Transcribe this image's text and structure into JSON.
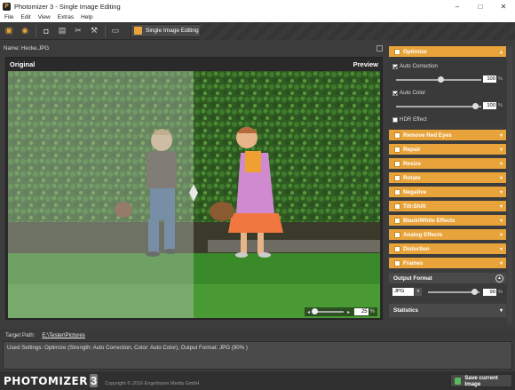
{
  "window": {
    "title": "Photomizer 3 - Single Image Editing",
    "btn_min": "–",
    "btn_max": "□",
    "btn_close": "✕"
  },
  "menu": [
    "File",
    "Edit",
    "View",
    "Extras",
    "Help"
  ],
  "toolbar": {
    "mode_label": "Single Image Editing",
    "mode_arrow": "▾"
  },
  "file": {
    "name_label": "Name: Hecke.JPG"
  },
  "image": {
    "left_label": "Original",
    "right_label": "Preview",
    "zoom_value": "25",
    "zoom_unit": "%"
  },
  "optimize": {
    "title": "Optimize",
    "auto_correction": {
      "label": "Auto Correction",
      "value": "100",
      "unit": "%",
      "level": 1.0
    },
    "auto_color": {
      "label": "Auto Color",
      "value": "100",
      "unit": "%",
      "level": 1.0
    },
    "hdr": {
      "label": "HDR Effect"
    }
  },
  "sections": [
    "Remove Red Eyes",
    "Repair",
    "Resize",
    "Rotate",
    "Negative",
    "Tilt-Shift",
    "Black/White Effects",
    "Analog Effects",
    "Distortion",
    "Frames"
  ],
  "output": {
    "title": "Output Format",
    "format": "JPG",
    "quality": "90",
    "unit": "%",
    "level": 0.9
  },
  "statistics": {
    "title": "Statistics"
  },
  "target": {
    "label": "Target Path:",
    "path": "E:\\Tester\\Pictures"
  },
  "used_settings": "Used Settings: Optimize (Strength: Auto Correction, Color: Auto Color), Output Format: JPG (90% )",
  "footer": {
    "logo": "PHOTOMIZER",
    "logo_num": "3",
    "copyright": "Copyright © 2016 Engelmann Media GmbH",
    "save_label": "Save current Image"
  }
}
